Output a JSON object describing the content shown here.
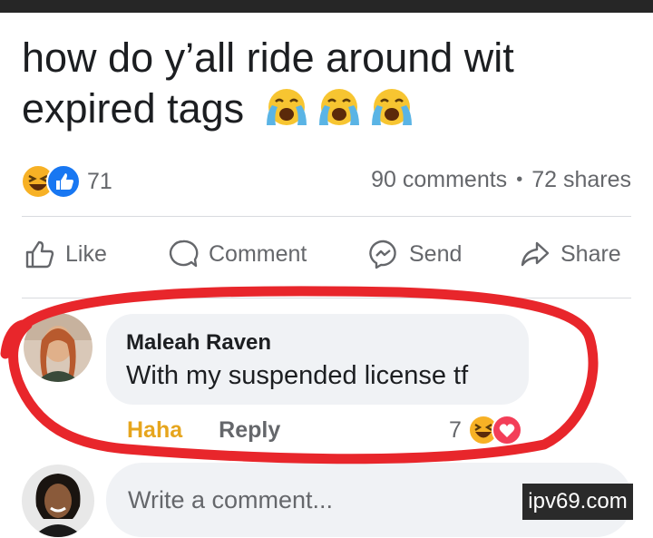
{
  "post": {
    "line1": "how do y’all ride around wit",
    "line2": "expired tags",
    "emojis": [
      "crying-face",
      "crying-face",
      "crying-face"
    ]
  },
  "stats": {
    "reaction_count": "71",
    "reactions": [
      "haha",
      "like"
    ],
    "comments": "90 comments",
    "separator": "•",
    "shares": "72 shares"
  },
  "actions": {
    "like": "Like",
    "comment": "Comment",
    "send": "Send",
    "share": "Share"
  },
  "comment": {
    "author": "Maleah Raven",
    "text": "With my suspended license tf",
    "haha_label": "Haha",
    "reply_label": "Reply",
    "reaction_count": "7",
    "reactions": [
      "haha",
      "love"
    ]
  },
  "composer": {
    "placeholder": "Write a comment..."
  },
  "watermark": "ipv69.com",
  "colors": {
    "text": "#1c1e21",
    "muted": "#65676b",
    "bubble": "#f0f2f5",
    "like_blue": "#1877f2",
    "haha_yellow": "#f7b125",
    "haha_label": "#e6a51d",
    "love_red": "#f33e58",
    "annotation_red": "#e8262b"
  }
}
